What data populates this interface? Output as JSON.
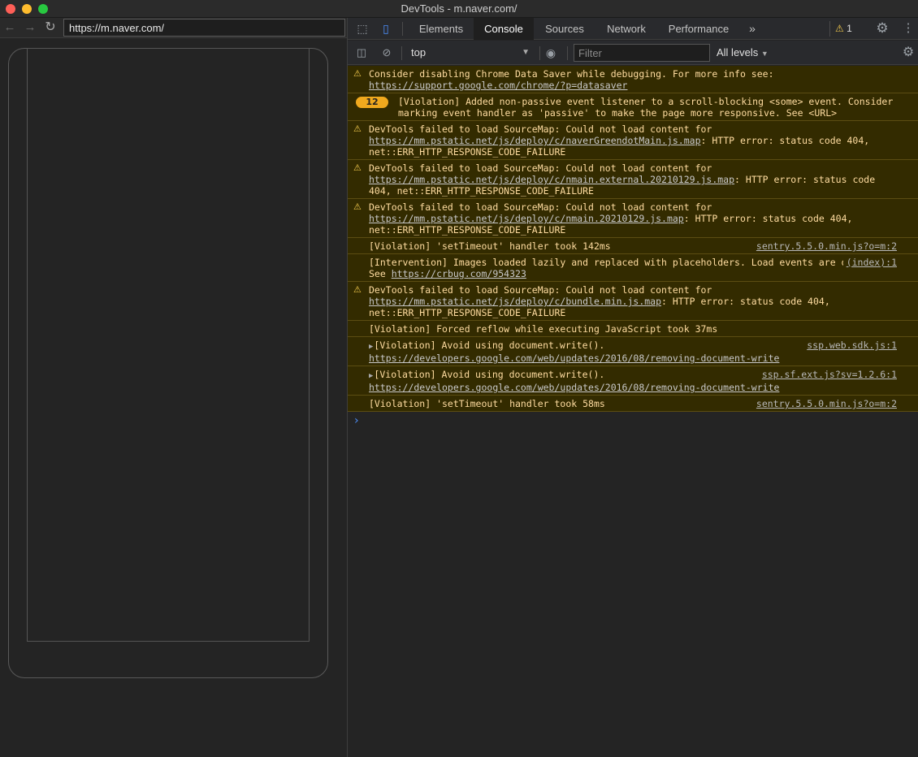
{
  "window": {
    "title": "DevTools - m.naver.com/"
  },
  "browser": {
    "url": "https://m.naver.com/",
    "back_icon": "arrow-left",
    "forward_icon": "arrow-right",
    "reload_icon": "reload"
  },
  "devtools": {
    "tabs": [
      {
        "label": "Elements",
        "active": false
      },
      {
        "label": "Console",
        "active": true
      },
      {
        "label": "Sources",
        "active": false
      },
      {
        "label": "Network",
        "active": false
      },
      {
        "label": "Performance",
        "active": false
      }
    ],
    "more_tabs": "»",
    "warning_count": "1",
    "context": "top",
    "filter_placeholder": "Filter",
    "levels": "All levels",
    "colors": {
      "warning_bg": "#332b00",
      "warning_text": "#ffdca0",
      "accent": "#4c8df6",
      "badge": "#f0a91e"
    }
  },
  "console": {
    "messages": [
      {
        "icon": "warning-icon",
        "text": "Consider disabling Chrome Data Saver while debugging. For more info see: ",
        "link": "https://support.google.com/chrome/?p=datasaver",
        "after": ""
      },
      {
        "count": "12",
        "text": "[Violation] Added non-passive event listener to a scroll-blocking <some> event. Consider marking event handler as 'passive' to make the page more responsive. See <URL>"
      },
      {
        "icon": "warning-icon",
        "text": "DevTools failed to load SourceMap: Could not load content for ",
        "link": "https://mm.pstatic.net/js/deploy/c/naverGreendotMain.js.map",
        "after": ": HTTP error: status code 404, net::ERR_HTTP_RESPONSE_CODE_FAILURE"
      },
      {
        "icon": "warning-icon",
        "text": "DevTools failed to load SourceMap: Could not load content for ",
        "link": "https://mm.pstatic.net/js/deploy/c/nmain.external.20210129.js.map",
        "after": ": HTTP error: status code 404, net::ERR_HTTP_RESPONSE_CODE_FAILURE"
      },
      {
        "icon": "warning-icon",
        "text": "DevTools failed to load SourceMap: Could not load content for ",
        "link": "https://mm.pstatic.net/js/deploy/c/nmain.20210129.js.map",
        "after": ": HTTP error: status code 404, net::ERR_HTTP_RESPONSE_CODE_FAILURE"
      },
      {
        "text": "[Violation] 'setTimeout' handler took 142ms",
        "source": "sentry.5.5.0.min.js?o=m:2"
      },
      {
        "text": "[Intervention] Images loaded lazily and replaced with placeholders. Load events are deferred. See ",
        "link": "https://crbug.com/954323",
        "source": "(index):1"
      },
      {
        "icon": "warning-icon",
        "text": "DevTools failed to load SourceMap: Could not load content for ",
        "link": "https://mm.pstatic.net/js/deploy/c/bundle.min.js.map",
        "after": ": HTTP error: status code 404, net::ERR_HTTP_RESPONSE_CODE_FAILURE"
      },
      {
        "text": "[Violation] Forced reflow while executing JavaScript took 37ms"
      },
      {
        "expandable": true,
        "text": "[Violation] Avoid using document.write(). ",
        "link": "https://developers.google.com/web/updates/2016/08/removing-document-write",
        "source": "ssp.web.sdk.js:1"
      },
      {
        "expandable": true,
        "text": "[Violation] Avoid using document.write(). ",
        "link": "https://developers.google.com/web/updates/2016/08/removing-document-write",
        "source": "ssp.sf.ext.js?sv=1.2.6:1"
      },
      {
        "text": "[Violation] 'setTimeout' handler took 58ms",
        "source": "sentry.5.5.0.min.js?o=m:2"
      }
    ],
    "prompt": "›"
  }
}
